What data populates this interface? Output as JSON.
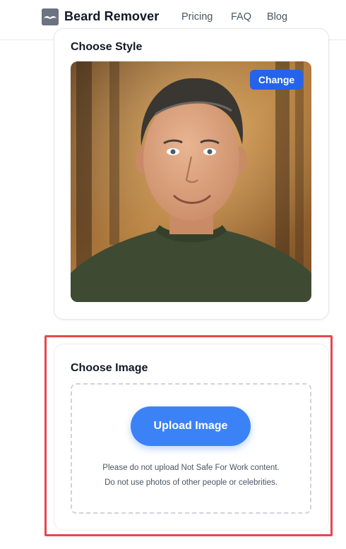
{
  "header": {
    "brand": "Beard Remover",
    "logo_icon": "mustache-logo-icon",
    "nav": [
      {
        "label": "Pricing"
      },
      {
        "label": "FAQ"
      },
      {
        "label": "Blog"
      }
    ]
  },
  "style_section": {
    "title": "Choose Style",
    "change_label": "Change",
    "preview_image": "portrait-photo"
  },
  "image_section": {
    "title": "Choose Image",
    "upload_label": "Upload Image",
    "note_line1": "Please do not upload Not Safe For Work content.",
    "note_line2": "Do not use photos of other people or celebrities."
  },
  "colors": {
    "accent": "#3b82f6",
    "change_button": "#2563eb",
    "highlight_border": "#e5484d"
  }
}
